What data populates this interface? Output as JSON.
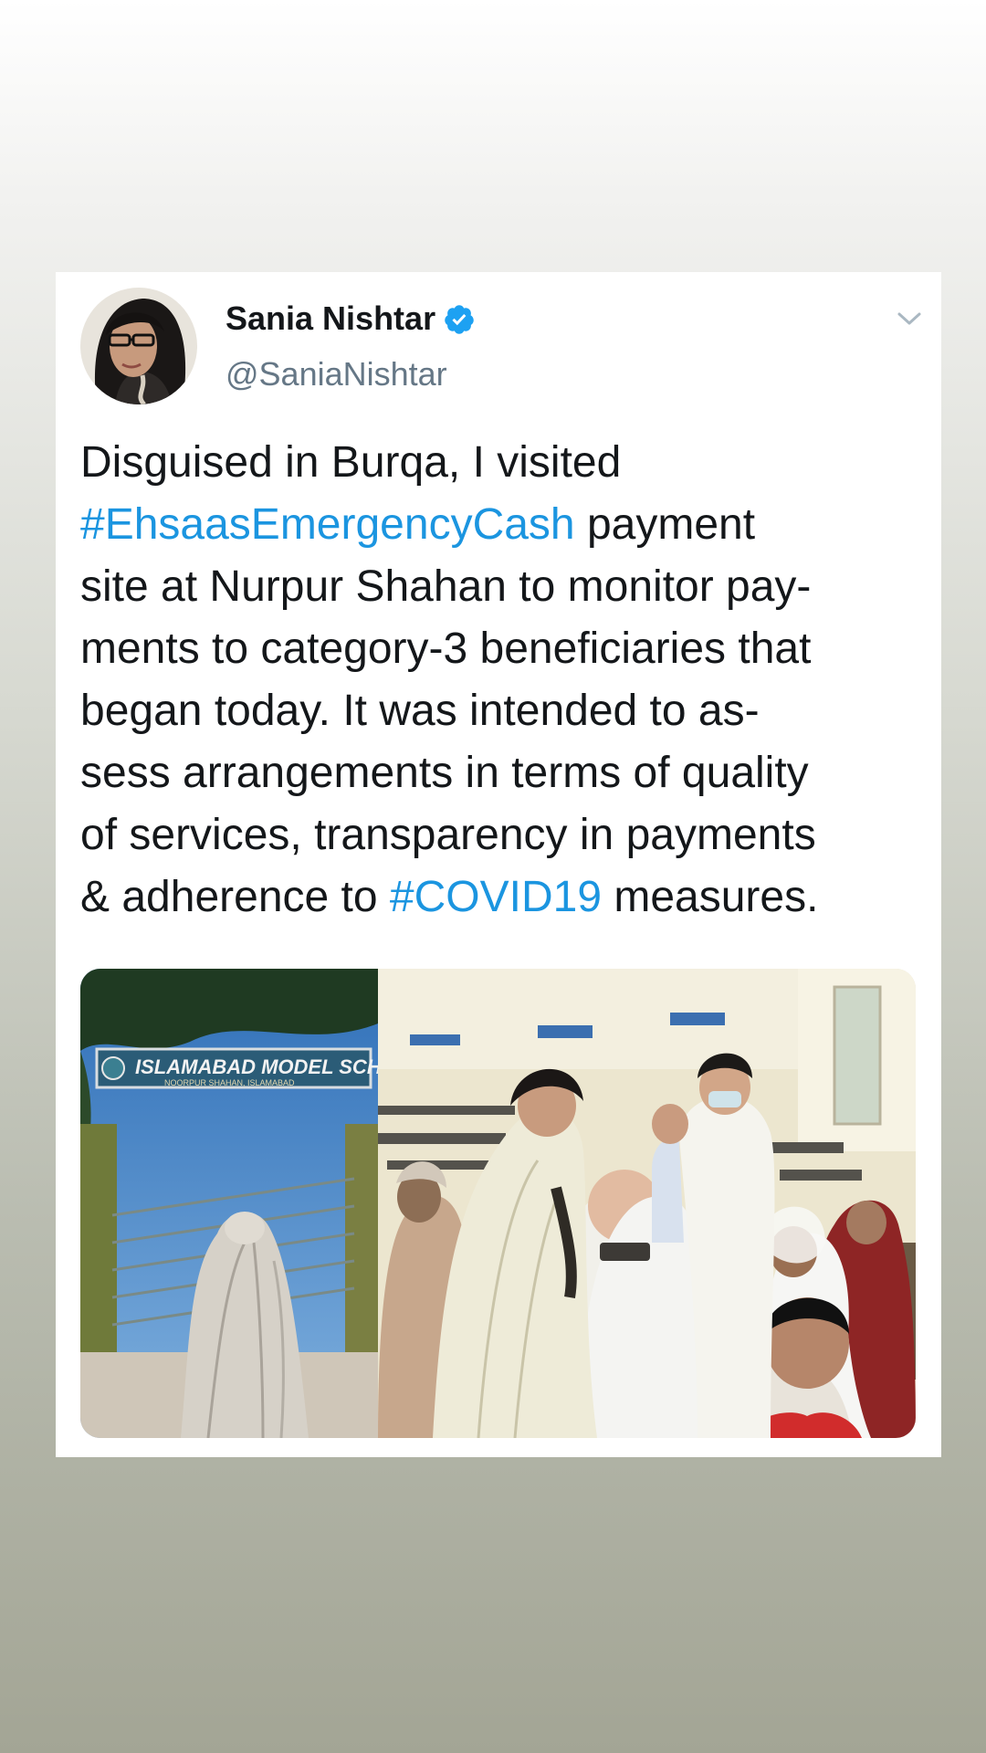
{
  "tweet": {
    "user_name": "Sania Nishtar",
    "handle": "@SaniaNishtar",
    "verified": true,
    "text_lines": [
      [
        {
          "text": "Disguised in Burqa, I visited",
          "type": "plain"
        }
      ],
      [
        {
          "text": "#EhsaasEmergencyCash",
          "type": "hashtag"
        },
        {
          "text": " payment",
          "type": "plain"
        }
      ],
      [
        {
          "text": "site at Nurpur Shahan to monitor pay-",
          "type": "plain"
        }
      ],
      [
        {
          "text": "ments to category-3 beneficiaries that",
          "type": "plain"
        }
      ],
      [
        {
          "text": "began today. It was intended to as-",
          "type": "plain"
        }
      ],
      [
        {
          "text": "sess arrangements in terms of quality",
          "type": "plain"
        }
      ],
      [
        {
          "text": "of services, transparency in payments",
          "type": "plain"
        }
      ],
      [
        {
          "text": "& adherence to ",
          "type": "plain"
        },
        {
          "text": "#COVID19",
          "type": "hashtag"
        },
        {
          "text": " measures.",
          "type": "plain"
        }
      ]
    ],
    "media": {
      "left_photo": {
        "sign_title": "ISLAMABAD MODEL SCHOO",
        "sign_subtitle": "NOORPUR SHAHAN, ISLAMABAD"
      }
    }
  },
  "colors": {
    "hashtag": "#1b95e0",
    "verified": "#1da1f2",
    "text": "#14171a",
    "handle": "#657786"
  },
  "icons": {
    "verified": "verified-badge-icon",
    "menu": "chevron-down-icon"
  }
}
